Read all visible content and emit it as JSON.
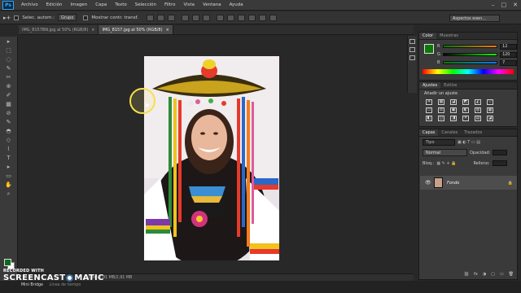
{
  "app": {
    "logo": "Ps"
  },
  "menu": [
    "Archivo",
    "Edición",
    "Imagen",
    "Capa",
    "Texto",
    "Selección",
    "Filtro",
    "Vista",
    "Ventana",
    "Ayuda"
  ],
  "window_controls": [
    "–",
    "□",
    "✕"
  ],
  "options": {
    "auto_select_label": "Selec. autom.:",
    "auto_select_value": "Grupo",
    "transform_label": "Mostrar contr. transf.",
    "workspace": "Aspectos esen..."
  },
  "tabs": [
    {
      "label": "IMG_8157BN.jpg al 50% (RGB/8)",
      "close": "×",
      "active": false
    },
    {
      "label": "IMG_8157.jpg al 50% (RGB/8)",
      "close": "×",
      "active": true
    }
  ],
  "status": {
    "doc": "Doc: 2,91 MB/2,91 MB"
  },
  "color_panel": {
    "tabs": [
      "Color",
      "Muestras"
    ],
    "r_label": "R",
    "r_value": "12",
    "g_label": "G",
    "g_value": "120",
    "b_label": "B",
    "b_value": "7",
    "fg_color": "#0c7807"
  },
  "adjust_panel": {
    "tabs": [
      "Ajustes",
      "Estilos"
    ],
    "title": "Añadir un ajuste",
    "icons": [
      "☀",
      "▦",
      "◪",
      "◩",
      "◭",
      "▽",
      "▭",
      "⚖",
      "▣",
      "◐",
      "◍",
      "▦",
      "◧",
      "◫",
      "◨",
      "✕",
      "▤",
      "◪"
    ]
  },
  "layers_panel": {
    "tabs": [
      "Capas",
      "Canales",
      "Trazados"
    ],
    "filter": "Tipo",
    "blend_mode": "Normal",
    "opacity_label": "Opacidad:",
    "lock_label": "Bloq.:",
    "fill_label": "Relleno:",
    "layer_name": "Fondo",
    "footer_icons": [
      "⛓",
      "fx",
      "◑",
      "▢",
      "▭",
      "🗑"
    ]
  },
  "toolbar_icons": [
    "▸",
    "⬚",
    "◌",
    "✎",
    "✂",
    "⊕",
    "✐",
    "▦",
    "⊘",
    "✎",
    "◓",
    "◇",
    "⌇",
    "T",
    "▸",
    "▭",
    "✋",
    "⌕"
  ],
  "watermark": {
    "top": "RECORDED WITH",
    "brand_left": "SCREENCAST",
    "brand_right": "MATIC"
  },
  "minibridge": {
    "label": "Mini Bridge",
    "timeline": "Línea de tiempo"
  }
}
